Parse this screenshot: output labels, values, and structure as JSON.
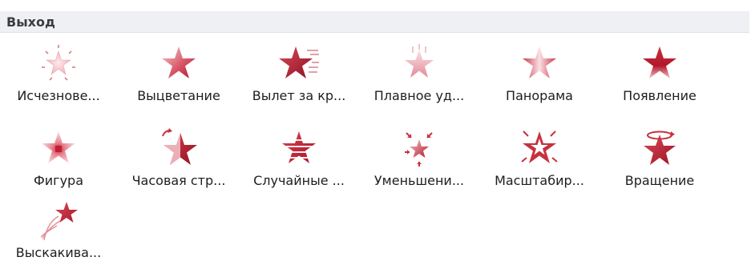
{
  "section": {
    "title": "Выход"
  },
  "effects": [
    {
      "label": "Исчезнове...",
      "icon": "fade-star-icon"
    },
    {
      "label": "Выцветание",
      "icon": "fade-out-star-icon"
    },
    {
      "label": "Вылет за кр...",
      "icon": "fly-out-star-icon"
    },
    {
      "label": "Плавное уд...",
      "icon": "float-out-star-icon"
    },
    {
      "label": "Панорама",
      "icon": "split-star-icon"
    },
    {
      "label": "Появление",
      "icon": "wipe-star-icon"
    },
    {
      "label": "Фигура",
      "icon": "shape-star-icon"
    },
    {
      "label": "Часовая стр...",
      "icon": "wheel-star-icon"
    },
    {
      "label": "Случайные ...",
      "icon": "random-bars-star-icon"
    },
    {
      "label": "Уменьшени...",
      "icon": "shrink-turn-star-icon"
    },
    {
      "label": "Масштабир...",
      "icon": "zoom-star-icon"
    },
    {
      "label": "Вращение",
      "icon": "swivel-star-icon"
    },
    {
      "label": "Выскакива...",
      "icon": "bounce-star-icon"
    }
  ],
  "colors": {
    "star_dark": "#b81d2c",
    "star_light": "#f5c6cc",
    "accent": "#c8303d"
  }
}
